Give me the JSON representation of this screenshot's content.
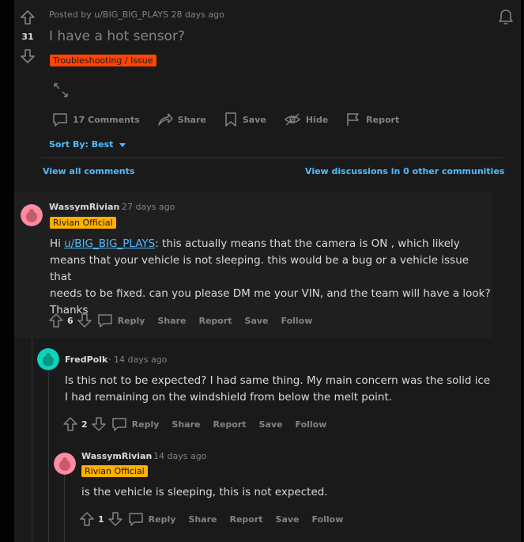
{
  "post": {
    "score": "31",
    "meta": "Posted by u/BIG_BIG_PLAYS 28 days ago",
    "title": "I have a hot sensor?",
    "flair": "Troubleshooting / Issue",
    "actions": {
      "comments": "17 Comments",
      "share": "Share",
      "save": "Save",
      "hide": "Hide",
      "report": "Report"
    },
    "sort_by": "Sort By: Best",
    "view_all": "View all comments",
    "view_discussions": "View discussions in 0 other communities"
  },
  "comments": [
    {
      "author": "WassymRivian",
      "time": "· 27 days ago",
      "flair": "Rivian Official",
      "mention": "u/BIG_BIG_PLAYS",
      "body_line1_rest": ": this actually means that the camera is ON , which likely",
      "body_prefix": "Hi ",
      "body_line2": "means that your vehicle is not sleeping. this would be a bug or a vehicle issue that",
      "body_line3": "needs to be fixed. can you please DM me your VIN, and the team will have a look?",
      "body_line4": "Thanks",
      "votes": "6",
      "reply": "Reply",
      "share": "Share",
      "report": "Report",
      "save": "Save",
      "follow": "Follow"
    },
    {
      "author": "FredPolk",
      "time": "· 14 days ago",
      "body_line1": "Is this not to be expected? I had same thing. My main concern was the solid ice",
      "body_line2": "I had remaining on the windshield from below the melt point.",
      "votes": "2",
      "reply": "Reply",
      "share": "Share",
      "report": "Report",
      "save": "Save",
      "follow": "Follow"
    },
    {
      "author": "WassymRivian",
      "time": "· 14 days ago",
      "flair": "Rivian Official",
      "body_line1": "is the vehicle is sleeping, this is not expected.",
      "votes": "1",
      "reply": "Reply",
      "share": "Share",
      "report": "Report",
      "save": "Save",
      "follow": "Follow"
    }
  ],
  "colors": {
    "accent_blue": "#4fbcff",
    "flair_orange": "#ff4500",
    "flair_yellow": "#ffb000",
    "avatar_pink": "#ff8b9e",
    "avatar_teal": "#0dd3bb"
  }
}
